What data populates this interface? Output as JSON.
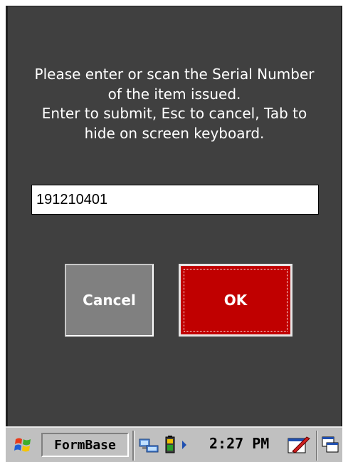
{
  "dialog": {
    "message_lines": [
      "Please enter or scan the Serial Number",
      "of the item issued.",
      "Enter to submit, Esc to cancel, Tab to",
      "hide on screen keyboard."
    ],
    "serial_input": {
      "value": "191210401"
    },
    "cancel_label": "Cancel",
    "ok_label": "OK"
  },
  "taskbar": {
    "start_icon": "windows-flag-icon",
    "task_label": "FormBase",
    "tray_icons": [
      "network-icon",
      "battery-icon",
      "tray-arrow-icon"
    ],
    "clock": "2:27 PM",
    "input_panel_icon": "input-panel-icon",
    "desktop_icon": "show-desktop-icon"
  },
  "colors": {
    "background": "#404040",
    "ok_button": "#c00000",
    "cancel_button": "#808080",
    "taskbar": "#c0c0c0"
  }
}
